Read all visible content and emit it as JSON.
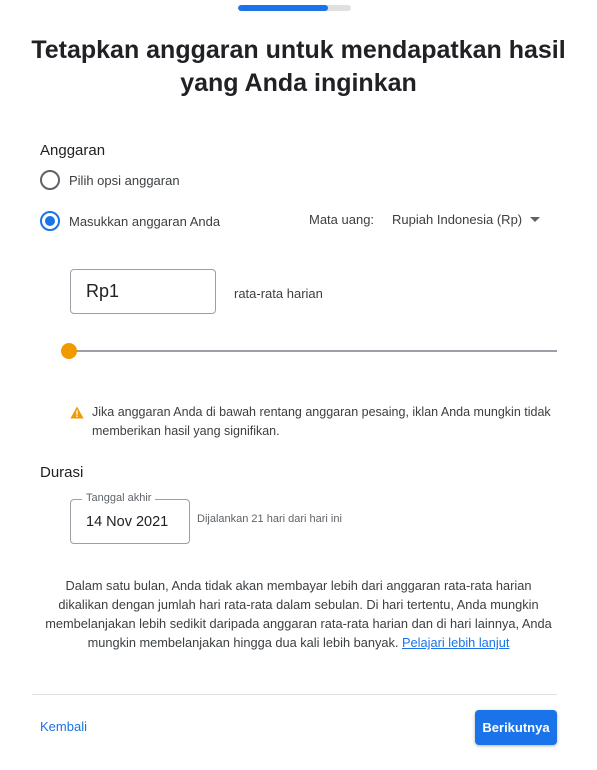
{
  "progress": {
    "fraction": 0.8
  },
  "title": "Tetapkan anggaran untuk mendapatkan hasil yang Anda inginkan",
  "budget": {
    "section_label": "Anggaran",
    "option_choose": {
      "label": "Pilih opsi anggaran",
      "selected": false
    },
    "option_enter": {
      "label": "Masukkan anggaran Anda",
      "selected": true
    },
    "currency_label": "Mata uang:",
    "currency_value": "Rupiah Indonesia (Rp)",
    "amount": "Rp1",
    "amount_suffix": "rata-rata harian",
    "slider_level": 0.0,
    "slider_color": "#f29900",
    "warning_icon": "warning-triangle-icon",
    "warning_text": "Jika anggaran Anda di bawah rentang anggaran pesaing, iklan Anda mungkin tidak memberikan hasil yang signifikan."
  },
  "duration": {
    "section_label": "Durasi",
    "end_date_label": "Tanggal akhir",
    "end_date_value": "14 Nov 2021",
    "run_note": "Dijalankan 21 hari dari hari ini"
  },
  "info": {
    "text": "Dalam satu bulan, Anda tidak akan membayar lebih dari anggaran rata-rata harian dikalikan dengan jumlah hari rata-rata dalam sebulan. Di hari tertentu, Anda mungkin membelanjakan lebih sedikit daripada anggaran rata-rata harian dan di hari lainnya, Anda mungkin membelanjakan hingga dua kali lebih banyak.",
    "link_text": "Pelajari lebih lanjut"
  },
  "footer": {
    "back_label": "Kembali",
    "next_label": "Berikutnya"
  },
  "colors": {
    "accent": "#1a73e8",
    "warning": "#f29900"
  }
}
